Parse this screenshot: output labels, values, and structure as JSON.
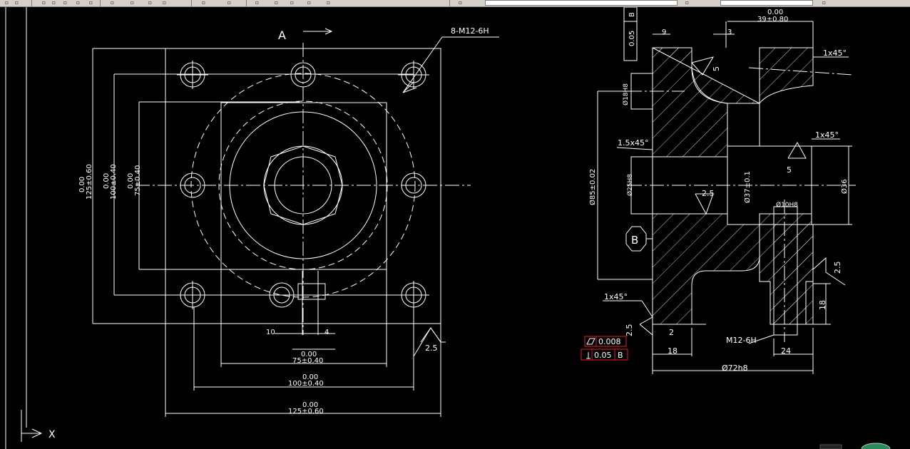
{
  "toolbar": {
    "icons": [
      "new-icon",
      "open-icon",
      "save-icon",
      "print-icon",
      "preview-icon",
      "cut-icon",
      "copy-icon",
      "paste-icon",
      "match-icon",
      "undo-icon",
      "redo-icon",
      "pan-icon",
      "zoom-icon",
      "zoom-window-icon",
      "properties-icon",
      "designcenter-icon",
      "toolpalette-icon",
      "help-icon",
      "layer-icon",
      "layer-state-icon",
      "color-icon",
      "linetype-icon"
    ]
  },
  "drawing": {
    "front": {
      "section_label": "A",
      "hole_callout": "8-M12-6H",
      "v_outer_tol": "0.00",
      "v_outer": "125±0.60",
      "v_mid_tol": "0.00",
      "v_mid": "100±0.40",
      "v_in_tol": "0.00",
      "v_in": "75±0.40",
      "dim_10": "10",
      "dim_4": "4",
      "h75_tol": "0.00",
      "h75": "75±0.40",
      "h100_tol": "0.00",
      "h100": "100±0.40",
      "h125_tol": "0.00",
      "h125": "125±0.60",
      "rough_25": "2.5"
    },
    "side": {
      "dim_top": "0.00",
      "dim_top2": "39±0.80",
      "dim_9": "9",
      "dim_3": "3",
      "chamfer1": "1x45°",
      "chamfer2": "1x45°",
      "chamfer3": "1.5x45°",
      "chamfer4": "1x45°",
      "flat_tol": "0.05",
      "datum_b_top": "B",
      "dia_18": "Ø18H8",
      "dia_85": "Ø85±0.02",
      "dia_25": "Ø25H8",
      "dia_37": "Ø37±0.1",
      "dia_36": "Ø36",
      "dia_10": "Ø10H8",
      "rough_5a": "5",
      "rough_5b": "5",
      "rough_25a": "2.5",
      "rough_25b": "2.5",
      "rough_25c": "2.5",
      "datum_b": "B",
      "dim_18v": "18",
      "dim_2": "2",
      "dim_18": "18",
      "dim_24": "24",
      "thread": "M12-6H",
      "dia_72": "Ø72h8",
      "flatness_val": "0.008",
      "perp_val": "0.05",
      "perp_datum": "B"
    },
    "ucs": {
      "x_label": "X"
    }
  },
  "colors": {
    "bg": "#000000",
    "line": "#ffffff",
    "frame": "#e02020",
    "toolbar": "#d4d0c8"
  }
}
